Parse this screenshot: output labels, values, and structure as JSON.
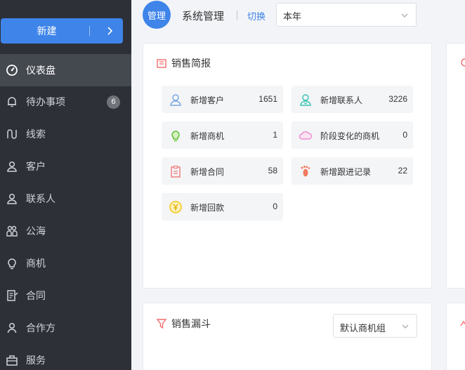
{
  "sidebar": {
    "new_button": "新建",
    "items": [
      {
        "label": "仪表盘",
        "icon": "dashboard-icon",
        "active": true
      },
      {
        "label": "待办事项",
        "icon": "bell-icon",
        "badge": "6"
      },
      {
        "label": "线索",
        "icon": "clue-icon"
      },
      {
        "label": "客户",
        "icon": "customer-icon"
      },
      {
        "label": "联系人",
        "icon": "contact-icon"
      },
      {
        "label": "公海",
        "icon": "public-pool-icon"
      },
      {
        "label": "商机",
        "icon": "bulb-icon"
      },
      {
        "label": "合同",
        "icon": "contract-icon"
      },
      {
        "label": "合作方",
        "icon": "partner-icon"
      },
      {
        "label": "服务",
        "icon": "service-icon"
      }
    ]
  },
  "header": {
    "avatar_text": "管理",
    "title": "系统管理",
    "switch_label": "切换",
    "period_select": "本年"
  },
  "sales_brief": {
    "title": "销售简报",
    "stats": [
      {
        "name": "新增客户",
        "value": "1651",
        "icon": "customer-icon",
        "color": "#7aa7e0"
      },
      {
        "name": "新增联系人",
        "value": "3226",
        "icon": "contact-icon",
        "color": "#3cc4b4"
      },
      {
        "name": "新增商机",
        "value": "1",
        "icon": "bulb-icon",
        "color": "#67c23a"
      },
      {
        "name": "阶段变化的商机",
        "value": "0",
        "icon": "cloud-icon",
        "color": "#e88ed0"
      },
      {
        "name": "新增合同",
        "value": "58",
        "icon": "clipboard-icon",
        "color": "#f08080"
      },
      {
        "name": "新增跟进记录",
        "value": "22",
        "icon": "footprint-icon",
        "color": "#f07c5f"
      },
      {
        "name": "新增回款",
        "value": "0",
        "icon": "yuan-coin-icon",
        "color": "#f5c518"
      }
    ]
  },
  "sales_funnel": {
    "title": "销售漏斗",
    "group_select": "默认商机组"
  },
  "colors": {
    "sidebar_bg": "#2d3037",
    "accent": "#3e84e9",
    "active_item": "#44484f"
  }
}
